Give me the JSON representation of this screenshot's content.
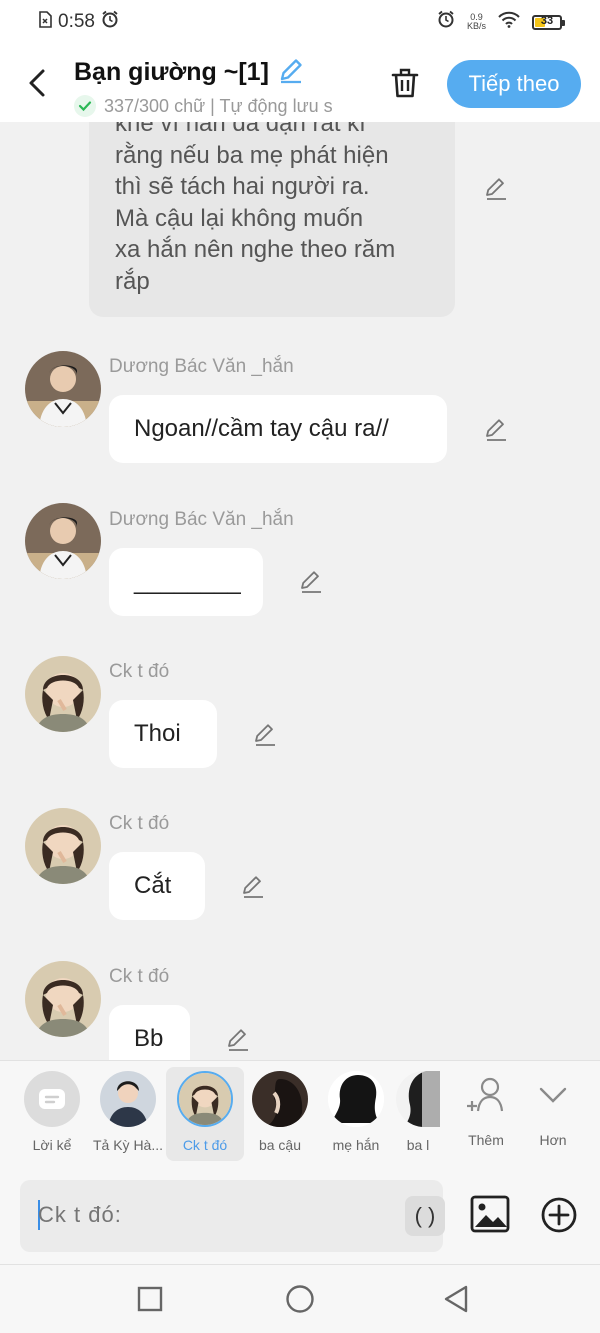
{
  "status_bar": {
    "time": "0:58",
    "net_speed_value": "0.9",
    "net_speed_unit": "KB/s",
    "battery_level": "33",
    "icons": [
      "sim-off-icon",
      "alarm-icon",
      "alarm-icon",
      "wifi-icon",
      "battery-icon"
    ]
  },
  "header": {
    "title": "Bạn giường ~[1]",
    "subtitle": "337/300 chữ | Tự động lưu s",
    "next_label": "Tiếp theo",
    "icons": [
      "back-arrow-icon",
      "edit-pencil-icon",
      "check-icon",
      "trash-icon"
    ]
  },
  "narration": {
    "lines": [
      "khe vì hắn đã dặn rất kĩ",
      "rằng nếu ba mẹ phát hiện",
      "thì sẽ tách hai người ra.",
      "Mà cậu lại không muốn",
      "xa hắn nên nghe theo răm",
      "rắp"
    ]
  },
  "messages": [
    {
      "sender": "Dương Bác Văn _hắn",
      "text": "Ngoan//cầm tay cậu ra//"
    },
    {
      "sender": "Dương Bác Văn _hắn",
      "text": "________"
    },
    {
      "sender": "Ck t đó",
      "text": "Thoi"
    },
    {
      "sender": "Ck t đó",
      "text": "Cắt"
    },
    {
      "sender": "Ck t đó",
      "text": "Bb"
    }
  ],
  "characters": [
    {
      "name": "Lời kể",
      "icon": "narration-bubble-icon"
    },
    {
      "name": "Tả Kỳ Hà..."
    },
    {
      "name": "Ck t đó",
      "selected": true
    },
    {
      "name": "ba cậu"
    },
    {
      "name": "mẹ hắn"
    },
    {
      "name": "ba l"
    }
  ],
  "tools": [
    {
      "name": "Thêm",
      "icon": "add-person-icon"
    },
    {
      "name": "Hơn",
      "icon": "chevron-down-icon"
    }
  ],
  "input": {
    "placeholder": "Ck t đó:",
    "paren_label": "( )",
    "icons": [
      "image-icon",
      "plus-circle-icon"
    ]
  },
  "nav": {
    "icons": [
      "recent-apps-square-icon",
      "home-circle-icon",
      "back-triangle-icon"
    ]
  },
  "colors": {
    "accent": "#56acf0",
    "selected_text": "#4d9be8",
    "check_green": "#2bb856",
    "battery": "#f5c518"
  }
}
